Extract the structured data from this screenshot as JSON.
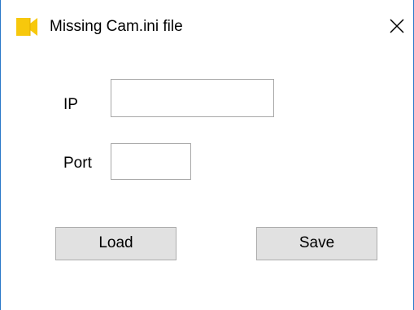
{
  "window": {
    "title": "Missing Cam.ini file",
    "icon": "video-camera-icon",
    "close_icon": "close-icon"
  },
  "form": {
    "ip_label": "IP",
    "ip_value": "",
    "port_label": "Port",
    "port_value": ""
  },
  "buttons": {
    "load_label": "Load",
    "save_label": "Save"
  },
  "colors": {
    "border_accent": "#2b79c9",
    "icon_yellow": "#f7c80c",
    "button_face": "#e1e1e1",
    "button_border": "#adadad",
    "input_border": "#a8a8a8"
  }
}
